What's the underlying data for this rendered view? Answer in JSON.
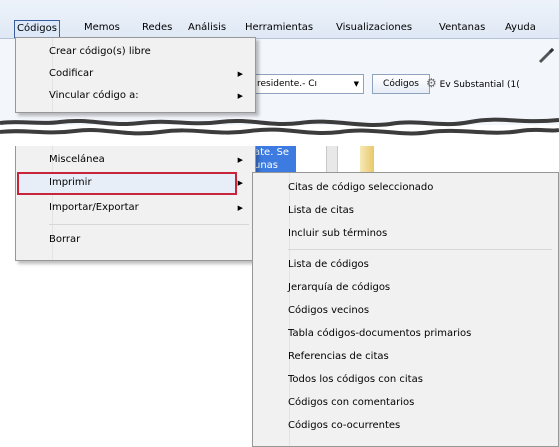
{
  "menubar": {
    "items": [
      {
        "label": "Códigos",
        "active": true
      },
      {
        "label": "Memos"
      },
      {
        "label": "Redes"
      },
      {
        "label": "Análisis"
      },
      {
        "label": "Herramientas"
      },
      {
        "label": "Visualizaciones"
      },
      {
        "label": "Ventanas"
      },
      {
        "label": "Ayuda"
      }
    ]
  },
  "toolbar": {
    "combo_value": "residente.- Cı",
    "codes_button": "Códigos",
    "substantial_label": "Ev Substantial (1("
  },
  "document": {
    "highlight_line1": "ate. Se",
    "highlight_line2": "unas"
  },
  "codigos_menu": {
    "top_items": [
      {
        "label": "Crear código(s) libre",
        "submenu": false
      },
      {
        "label": "Codificar",
        "submenu": true
      },
      {
        "label": "Vincular código a:",
        "submenu": true
      }
    ],
    "bottom_items": [
      {
        "label": "Miscelánea",
        "submenu": true
      },
      {
        "label": "Imprimir",
        "submenu": true,
        "selected": true
      },
      {
        "label": "Importar/Exportar",
        "submenu": true
      },
      {
        "label": "Borrar",
        "submenu": false
      }
    ]
  },
  "imprimir_submenu": {
    "group1": [
      "Citas de código seleccionado",
      "Lista de citas",
      "Incluir sub términos"
    ],
    "group2": [
      "Lista de códigos",
      "Jerarquía de códigos",
      "Códigos vecinos",
      "Tabla códigos-documentos primarios",
      "Referencias de citas",
      "Todos los códigos con citas",
      "Códigos con comentarios",
      "Códigos co-ocurrentes"
    ]
  },
  "colors": {
    "selection_border": "#c8243a",
    "highlight": "#3d7be0"
  },
  "icons": {
    "submenu": "triangle-right-icon",
    "tool": "pencil-icon",
    "substantial": "gear-icon"
  }
}
